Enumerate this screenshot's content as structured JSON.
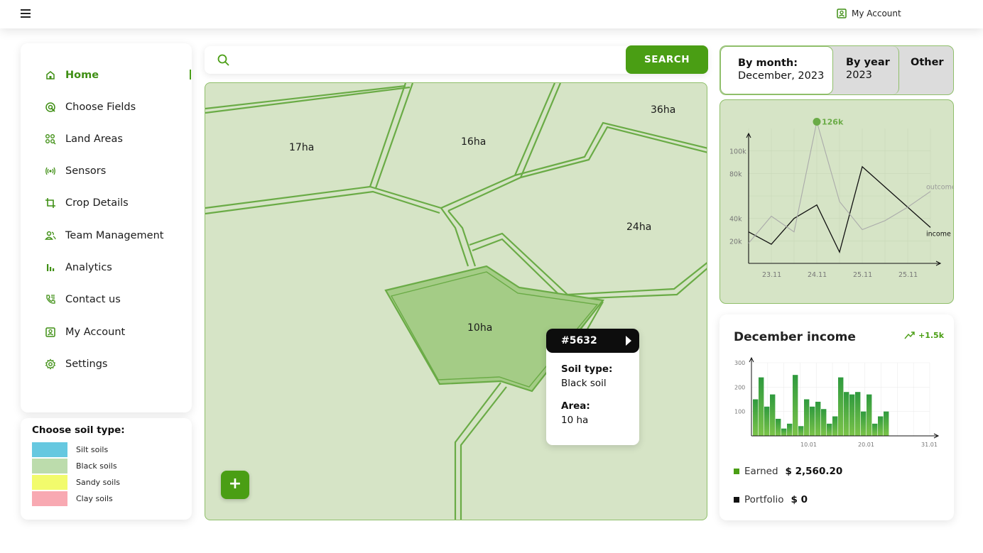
{
  "header": {
    "account_label": "My Account"
  },
  "sidebar": {
    "items": [
      {
        "label": "Home",
        "icon": "home-icon",
        "active": true
      },
      {
        "label": "Choose Fields",
        "icon": "target-icon"
      },
      {
        "label": "Land Areas",
        "icon": "land-areas-icon"
      },
      {
        "label": "Sensors",
        "icon": "sensor-icon"
      },
      {
        "label": "Crop Details",
        "icon": "crop-icon"
      },
      {
        "label": "Team Management",
        "icon": "team-icon"
      },
      {
        "label": "Analytics",
        "icon": "analytics-icon"
      },
      {
        "label": "Contact us",
        "icon": "phone-icon"
      },
      {
        "label": "My Account",
        "icon": "account-icon"
      },
      {
        "label": "Settings",
        "icon": "gear-icon"
      }
    ]
  },
  "soil": {
    "title": "Choose soil type:",
    "types": [
      {
        "label": "Silt soils",
        "color": "#66c8e0"
      },
      {
        "label": "Black soils",
        "color": "#bcdcac"
      },
      {
        "label": "Sandy soils",
        "color": "#f2fb6c"
      },
      {
        "label": "Clay soils",
        "color": "#f8a9b2"
      }
    ]
  },
  "search": {
    "placeholder": "",
    "button_label": "SEARCH"
  },
  "map": {
    "labels": {
      "f17": "17ha",
      "f16": "16ha",
      "f36": "36ha",
      "f24": "24ha",
      "f10": "10ha"
    },
    "popup": {
      "id": "#5632",
      "soil_key": "Soil type:",
      "soil_value": "Black soil",
      "area_key": "Area:",
      "area_value": "10 ha"
    },
    "add_label": "+"
  },
  "period_tabs": {
    "month": {
      "title": "By month:",
      "value": "December, 2023"
    },
    "year": {
      "title": "By year",
      "value": "2023"
    },
    "other": {
      "title": "Other"
    }
  },
  "colors": {
    "accent": "#4a9e14",
    "map_bg": "#d6e4c6",
    "field_border": "#6aab46"
  },
  "chart_data": [
    {
      "type": "line",
      "categories": [
        "23.11",
        "24.11",
        "25.11",
        "25.11"
      ],
      "yticks": [
        "20k",
        "40k",
        "80k",
        "100k"
      ],
      "ylim": [
        0,
        120000
      ],
      "peak_label": "126k",
      "series": [
        {
          "name": "income",
          "color": "#111111",
          "x": [
            0,
            0.5,
            1,
            1.5,
            2,
            2.5,
            3,
            3.5,
            4
          ],
          "y": [
            28000,
            17000,
            40000,
            52000,
            10000,
            86000,
            68000,
            50000,
            32000
          ]
        },
        {
          "name": "outcome",
          "color": "#aaaaaa",
          "x": [
            0,
            0.5,
            1,
            1.5,
            2,
            2.5,
            3,
            3.5,
            4
          ],
          "y": [
            18000,
            42000,
            28000,
            126000,
            55000,
            30000,
            38000,
            50000,
            64000
          ]
        }
      ]
    },
    {
      "type": "bar",
      "title": "December income",
      "delta": "+1.5k",
      "xticks": [
        "10.01",
        "20.01",
        "31.01"
      ],
      "yticks": [
        "100",
        "200",
        "300"
      ],
      "ylim": [
        0,
        300
      ],
      "values": [
        150,
        240,
        120,
        170,
        70,
        30,
        50,
        250,
        40,
        150,
        120,
        140,
        110,
        50,
        80,
        240,
        180,
        170,
        180,
        100,
        170,
        50,
        80,
        100
      ],
      "legend": [
        {
          "label": "Earned",
          "amount": "$ 2,560.20",
          "color": "#4a9e14"
        },
        {
          "label": "Portfolio",
          "amount": "$ 0",
          "color": "#111111"
        }
      ]
    }
  ]
}
